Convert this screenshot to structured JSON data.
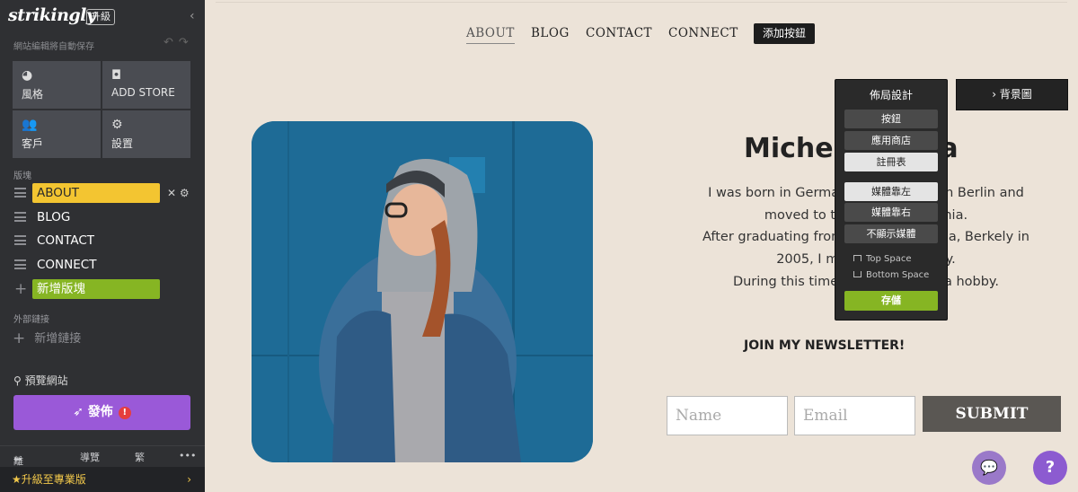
{
  "brand": {
    "logo": "strikingly",
    "upgrade_tag": "升級"
  },
  "sidebar": {
    "autosave": "網站編輯將自動保存",
    "tiles": [
      {
        "label": "風格",
        "icon": "palette-icon"
      },
      {
        "label": "ADD STORE",
        "icon": "store-icon"
      },
      {
        "label": "客戶",
        "icon": "users-icon"
      },
      {
        "label": "設置",
        "icon": "gear-icon"
      }
    ],
    "sections_label": "版塊",
    "sections": [
      {
        "label": "ABOUT"
      },
      {
        "label": "BLOG"
      },
      {
        "label": "CONTACT"
      },
      {
        "label": "CONNECT"
      }
    ],
    "add_section": "新增版塊",
    "external_label": "外部鏈接",
    "add_link": "新增鏈接",
    "preview": "預覽網站",
    "publish": "發佈",
    "publish_alert": "!",
    "bottom": {
      "exit": "離開",
      "guide": "導覽",
      "lang": "繁",
      "more": "•••"
    },
    "upgrade_pro": "升級至專業版"
  },
  "site": {
    "nav": [
      "ABOUT",
      "BLOG",
      "CONTACT",
      "CONNECT"
    ],
    "nav_add_button": "添加按鈕",
    "name": "Michel       ora",
    "bio": [
      "I was born in Germany in            up in Berlin and",
      "moved to the                   ornia.",
      "After graduating from the            fornia, Berkely in",
      "2005, I mov                    ity.",
      "During this time, I                    s a hobby."
    ],
    "newsletter_title": "JOIN MY NEWSLETTER!",
    "name_placeholder": "Name",
    "email_placeholder": "Email",
    "submit": "SUBMIT"
  },
  "layout_panel": {
    "title": "佈局設計",
    "buttons": [
      "按鈕",
      "應用商店",
      "註冊表"
    ],
    "media": [
      "媒體靠左",
      "媒體靠右",
      "不顯示媒體"
    ],
    "top_space": "Top Space",
    "bottom_space": "Bottom Space",
    "save": "存儲"
  },
  "background_button": "› 背景圖"
}
